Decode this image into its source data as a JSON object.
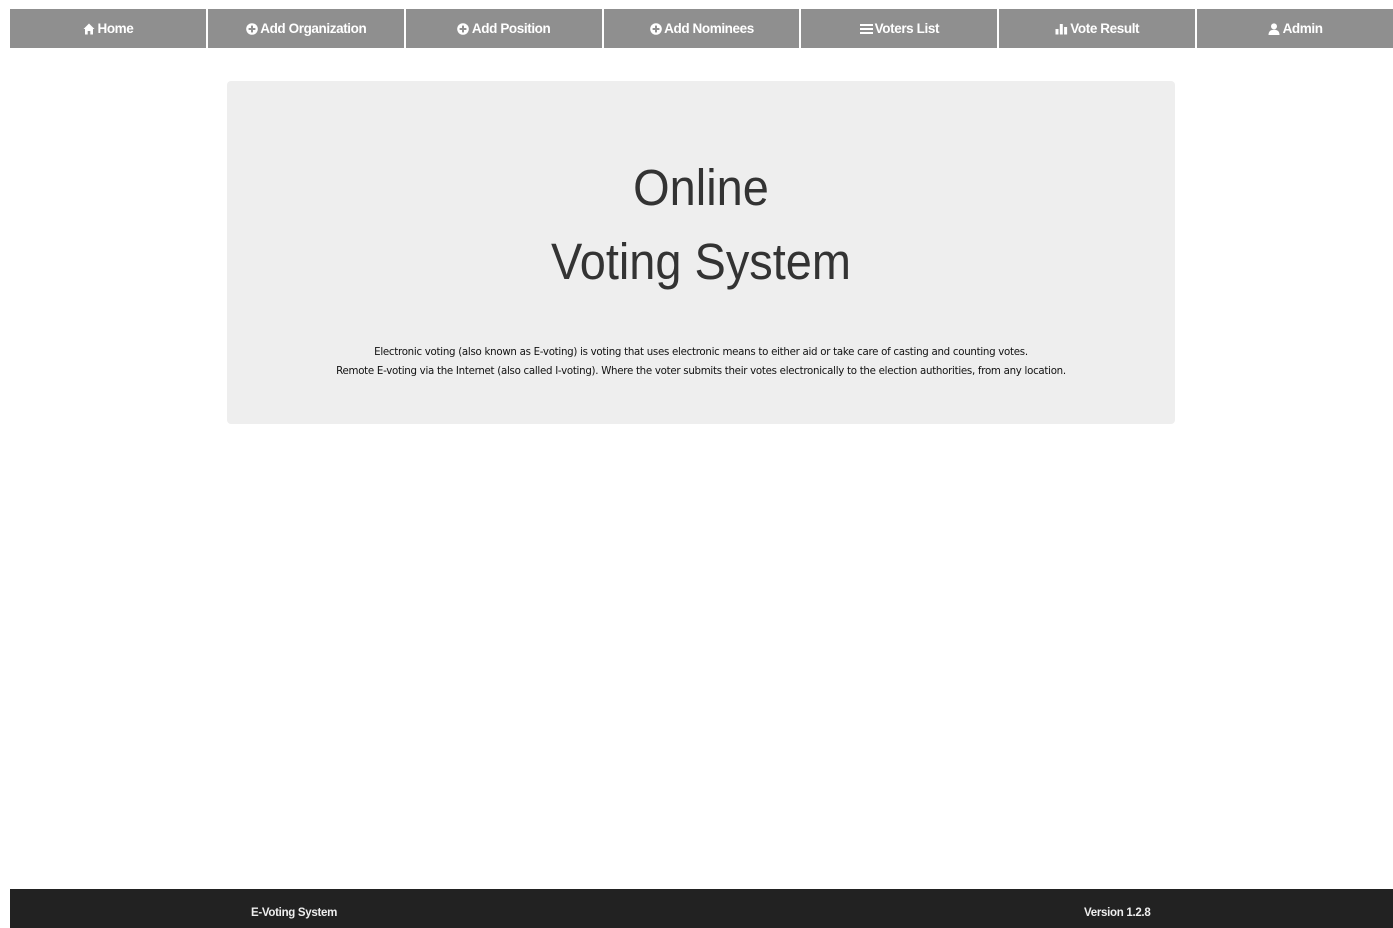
{
  "nav": {
    "items": [
      {
        "label": "Home",
        "icon": "home-icon"
      },
      {
        "label": "Add Organization",
        "icon": "plus-circle-icon"
      },
      {
        "label": "Add Position",
        "icon": "plus-circle-icon"
      },
      {
        "label": "Add Nominees",
        "icon": "plus-circle-icon"
      },
      {
        "label": "Voters List",
        "icon": "list-icon"
      },
      {
        "label": "Vote Result",
        "icon": "bar-chart-icon"
      },
      {
        "label": "Admin",
        "icon": "user-icon"
      }
    ]
  },
  "hero": {
    "title_line1": "Online",
    "title_line2": "Voting System",
    "text_line1": "Electronic voting (also known as E-voting) is voting that uses electronic means to either aid or take care of casting and counting votes.",
    "text_line2": "Remote E-voting via the Internet (also called I-voting). Where the voter submits their votes electronically to the election authorities, from any location."
  },
  "footer": {
    "app_name": "E-Voting System",
    "version": "Version 1.2.8"
  },
  "colors": {
    "nav_background": "#8f8f8f",
    "hero_background": "#eeeeee",
    "footer_background": "#222222"
  }
}
